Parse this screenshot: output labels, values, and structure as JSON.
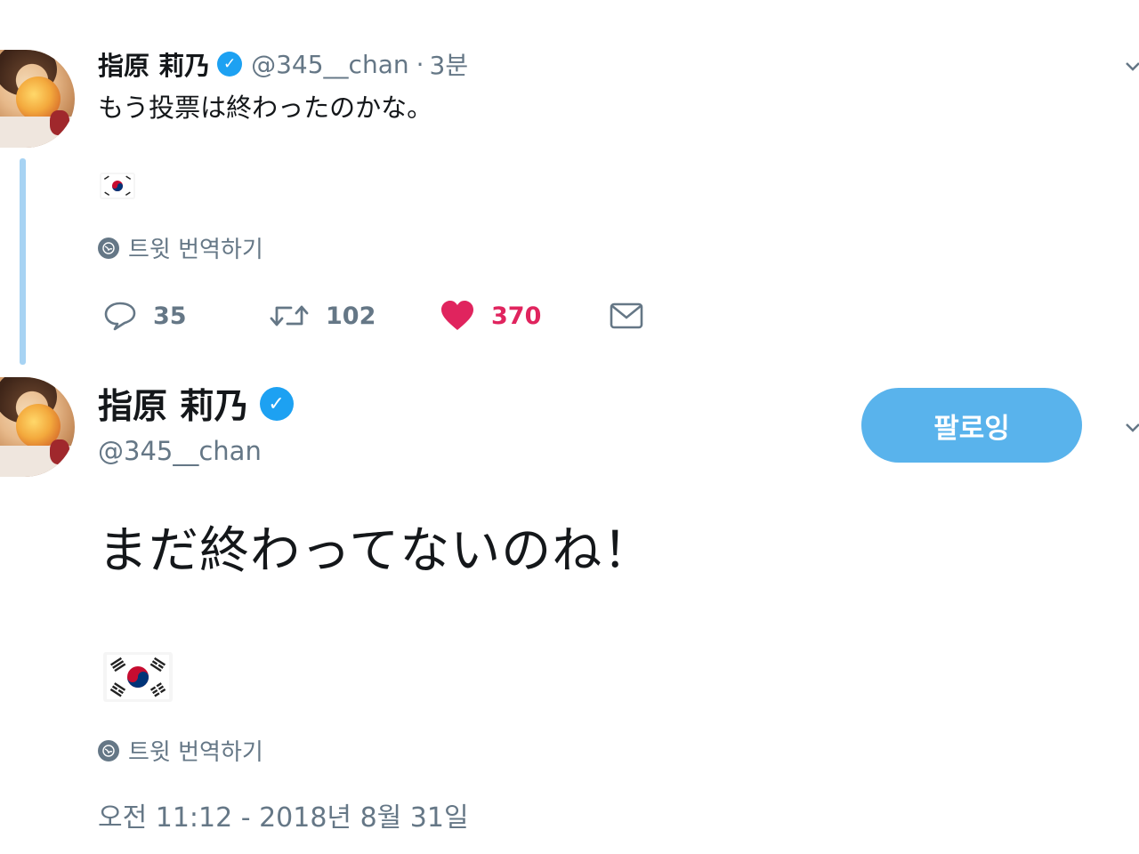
{
  "thread_tweet": {
    "display_name": "指原 莉乃",
    "handle": "@345__chan",
    "separator": "·",
    "time": "3분",
    "text": "もう投票は終わったのかな。",
    "flag_icon": "south-korea-flag-icon",
    "translate_label": "트윗 번역하기",
    "actions": {
      "reply_count": "35",
      "retweet_count": "102",
      "like_count": "370"
    }
  },
  "main_tweet": {
    "display_name": "指原 莉乃",
    "handle": "@345__chan",
    "follow_label": "팔로잉",
    "text": "まだ終わってないのね！",
    "flag_icon": "south-korea-flag-icon",
    "translate_label": "트윗 번역하기",
    "timestamp": "오전 11:12 - 2018년 8월 31일"
  },
  "colors": {
    "accent": "#1da1f2",
    "follow_button": "#59b3ec",
    "like": "#e0245e",
    "muted_text": "#657786",
    "thread_line": "#a7d3f3"
  }
}
